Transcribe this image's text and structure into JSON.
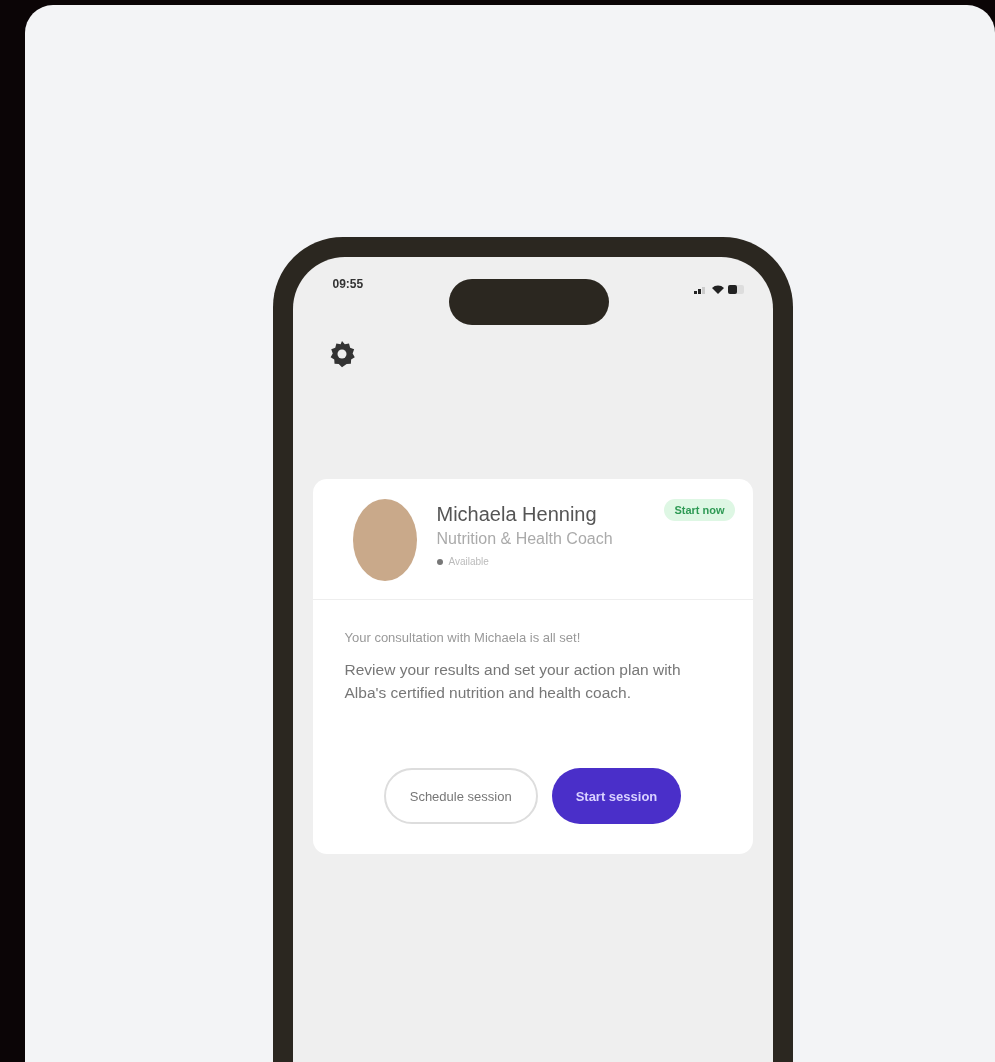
{
  "status_bar": {
    "time": "09:55"
  },
  "coach_card": {
    "name": "Michaela Henning",
    "role": "Nutrition & Health Coach",
    "status": "Available",
    "badge": "Start now",
    "messages": [
      "Your consultation with Michaela is all set!",
      "Review your results and set your action plan with Alba's certified nutrition and health coach."
    ],
    "buttons": [
      {
        "label": "Schedule session",
        "kind": "secondary"
      },
      {
        "label": "Start session",
        "kind": "primary"
      }
    ]
  }
}
